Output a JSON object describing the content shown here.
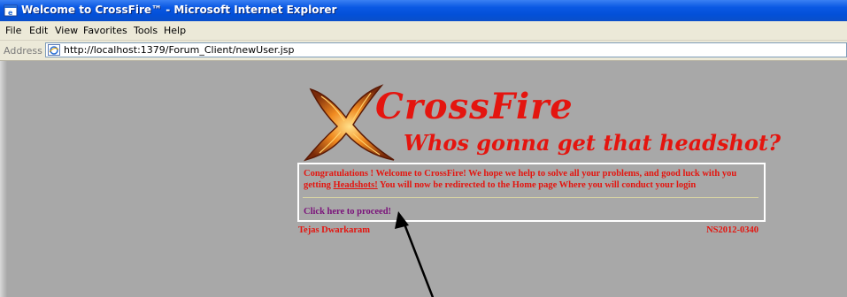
{
  "window": {
    "title": "Welcome to CrossFire™ - Microsoft Internet Explorer"
  },
  "menu": {
    "items": [
      "File",
      "Edit",
      "View",
      "Favorites",
      "Tools",
      "Help"
    ]
  },
  "address_bar": {
    "label": "Address",
    "url": "http://localhost:1379/Forum_Client/newUser.jsp"
  },
  "page": {
    "brand": "CrossFire",
    "tagline": "Whos gonna get that headshot?",
    "message_part1": "Congratulations ! Welcome to CrossFire! We hope we help to solve all your problems, and good luck with you getting ",
    "message_link": "Headshots!",
    "message_part2": " You will now be redirected to the Home page Where you will conduct your login",
    "proceed_link": "Click here to proceed!",
    "author": "Tejas Dwarkaram",
    "code": "NS2012-0340"
  },
  "colors": {
    "accent_red": "#e4150f",
    "link_purple": "#7a117a",
    "page_bg": "#a8a8a8",
    "titlebar_blue": "#0a58e3"
  },
  "icons": [
    "ie-window-icon",
    "ie-page-icon",
    "crossfire-logo-icon"
  ]
}
